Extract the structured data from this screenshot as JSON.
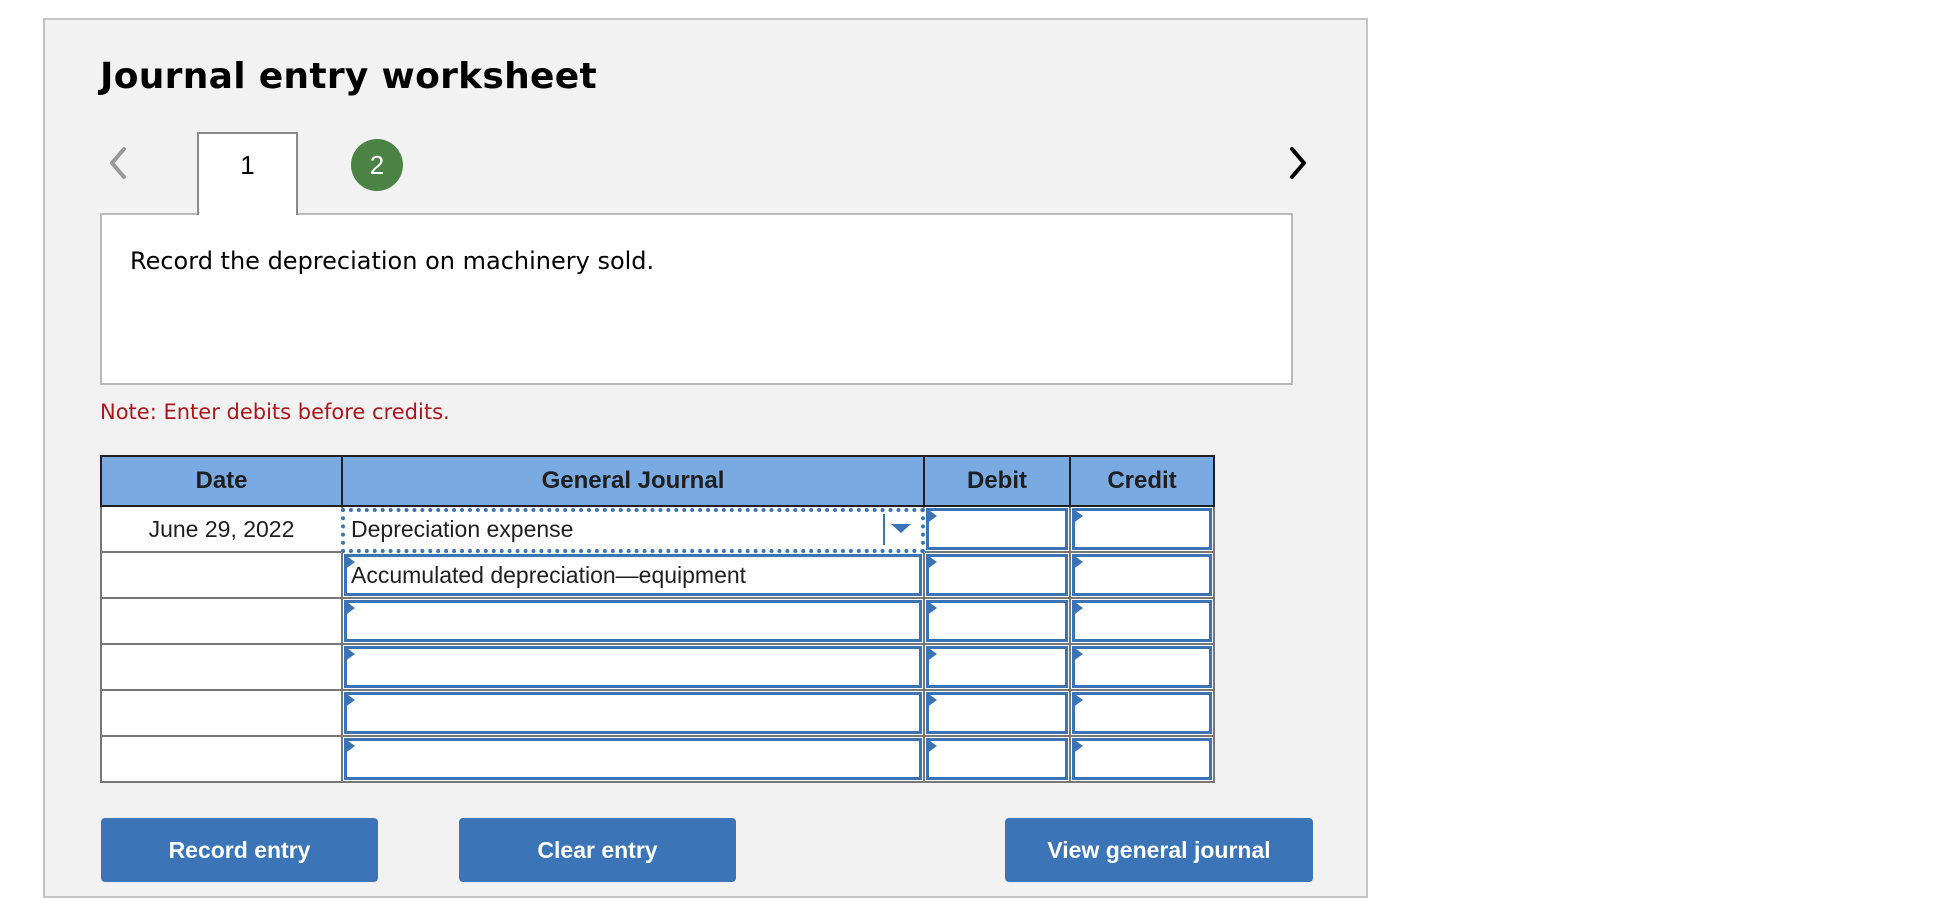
{
  "worksheet": {
    "title": "Journal entry worksheet",
    "tabs": [
      {
        "label": "1",
        "state": "active"
      },
      {
        "label": "2",
        "state": "completed"
      }
    ],
    "prev_icon": "chevron-left-icon",
    "next_icon": "chevron-right-icon",
    "prompt": "Record the depreciation on machinery sold.",
    "note": "Note: Enter debits before credits.",
    "colors": {
      "header_bg": "#7aaae2",
      "accent_blue": "#3a74b7",
      "completed_tab": "#4b8344",
      "note_red": "#b0151b",
      "panel_bg": "#f2f2f2"
    }
  },
  "table": {
    "columns": [
      "Date",
      "General Journal",
      "Debit",
      "Credit"
    ],
    "rows": [
      {
        "date": "June 29, 2022",
        "account": "Depreciation expense",
        "debit": "",
        "credit": ""
      },
      {
        "date": "",
        "account": "Accumulated depreciation—equipment",
        "debit": "",
        "credit": ""
      },
      {
        "date": "",
        "account": "",
        "debit": "",
        "credit": ""
      },
      {
        "date": "",
        "account": "",
        "debit": "",
        "credit": ""
      },
      {
        "date": "",
        "account": "",
        "debit": "",
        "credit": ""
      },
      {
        "date": "",
        "account": "",
        "debit": "",
        "credit": ""
      }
    ]
  },
  "buttons": {
    "record": "Record entry",
    "clear": "Clear entry",
    "view": "View general journal"
  }
}
